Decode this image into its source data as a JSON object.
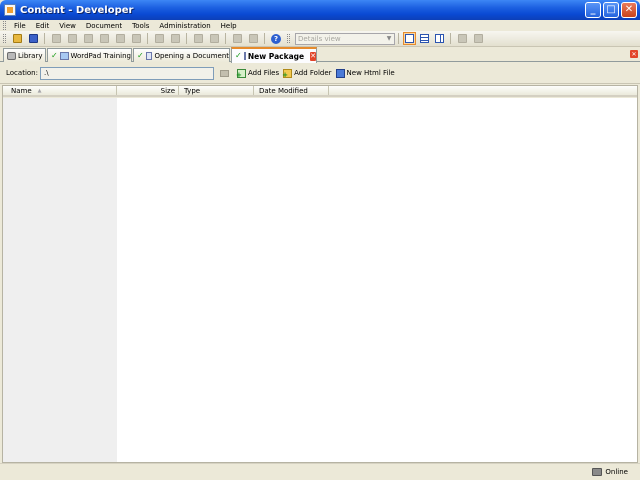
{
  "window": {
    "title": "Content - Developer",
    "buttons": {
      "minimize": "_",
      "maximize": "□",
      "close": "✕"
    }
  },
  "menu": [
    "File",
    "Edit",
    "View",
    "Document",
    "Tools",
    "Administration",
    "Help"
  ],
  "toolbar": {
    "view_mode": "Details view"
  },
  "tabs": [
    {
      "label": "Library",
      "icon": "library-icon",
      "checked": false
    },
    {
      "label": "WordPad Training",
      "icon": "wordpad-icon",
      "checked": true
    },
    {
      "label": "Opening a Document",
      "icon": "document-icon",
      "checked": true
    },
    {
      "label": "New Package",
      "icon": "package-icon",
      "checked": true,
      "active": true
    }
  ],
  "location": {
    "label": "Location:",
    "value": ".\\"
  },
  "actions": {
    "add_files": "Add Files",
    "add_folder": "Add Folder",
    "new_html_file": "New Html File"
  },
  "columns": [
    "Name",
    "Size",
    "Type",
    "Date Modified"
  ],
  "status": {
    "text": "Online"
  },
  "colors": {
    "titlebar": "#0a4ad4",
    "active_tab_accent": "#e68b2c",
    "close_red": "#e2452a"
  }
}
